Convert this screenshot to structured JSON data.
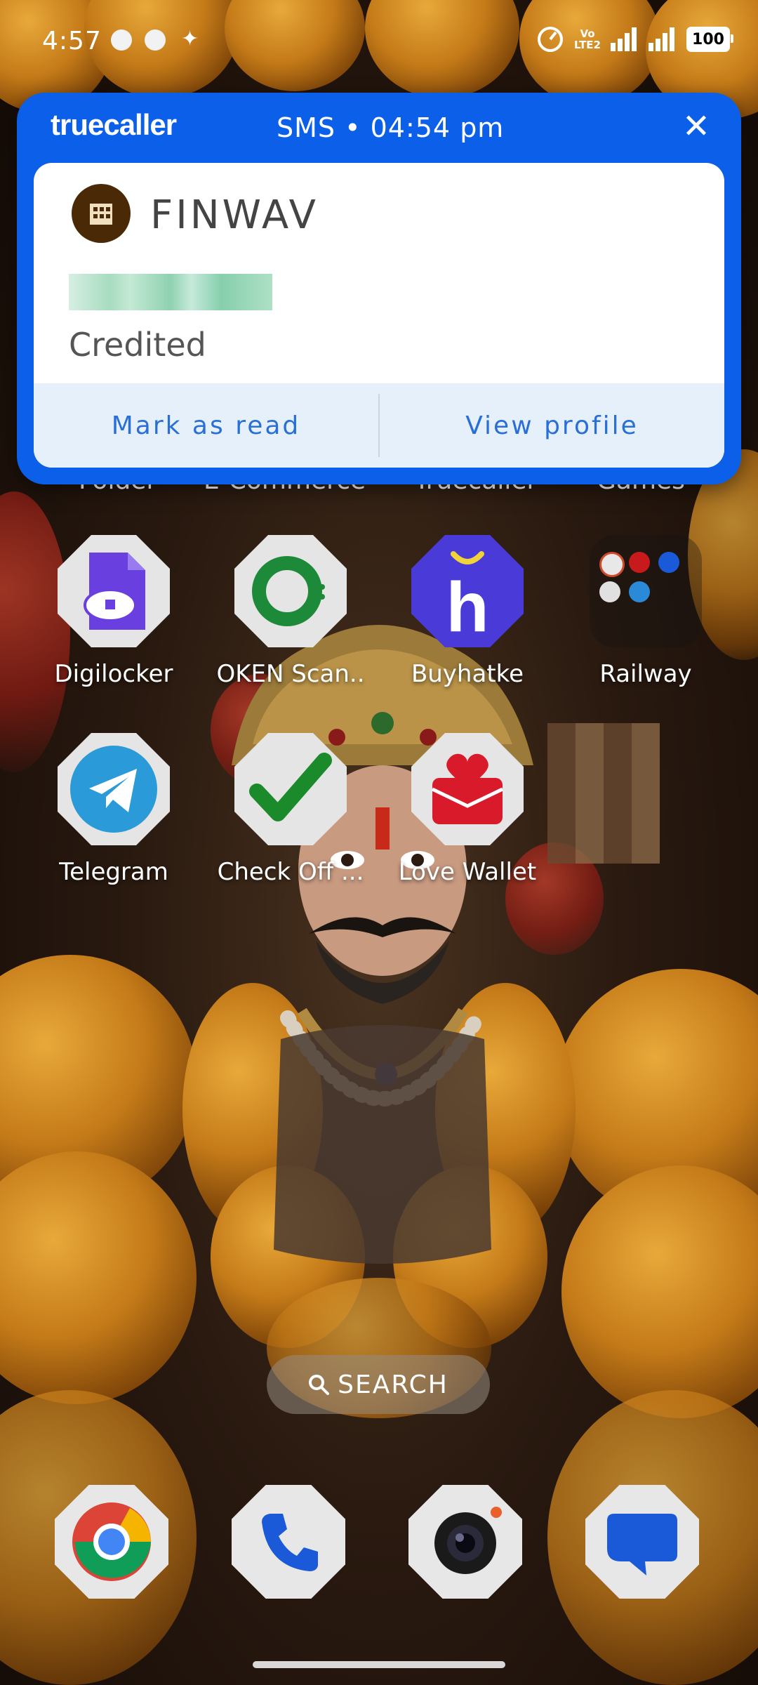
{
  "status_bar": {
    "time": "4:57",
    "volte_line1": "Vo",
    "volte_line2": "LTE2",
    "battery": "100"
  },
  "popup": {
    "brand": "truecaller",
    "meta": "SMS • 04:54 pm",
    "sender": "FINWAV",
    "message": "Credited",
    "actions": [
      "Mark as read",
      "View profile"
    ],
    "brand_color": "#0b5fe8"
  },
  "hidden_row_labels": [
    "Folder",
    "E-Commerce",
    "Truecaller",
    "Games"
  ],
  "apps": [
    {
      "label": "Digilocker",
      "icon": "digilocker-icon"
    },
    {
      "label": "OKEN Scan..",
      "icon": "oken-scanner-icon"
    },
    {
      "label": "Buyhatke",
      "icon": "buyhatke-icon"
    },
    {
      "label": "Railway",
      "icon": "railway-folder-icon"
    },
    {
      "label": "Telegram",
      "icon": "telegram-icon"
    },
    {
      "label": "Check Off ...",
      "icon": "check-off-icon"
    },
    {
      "label": "Love Wallet",
      "icon": "love-wallet-icon"
    }
  ],
  "search": {
    "label": "SEARCH"
  },
  "dock": [
    {
      "icon": "chrome-icon"
    },
    {
      "icon": "phone-icon"
    },
    {
      "icon": "camera-icon"
    },
    {
      "icon": "messages-icon"
    }
  ]
}
